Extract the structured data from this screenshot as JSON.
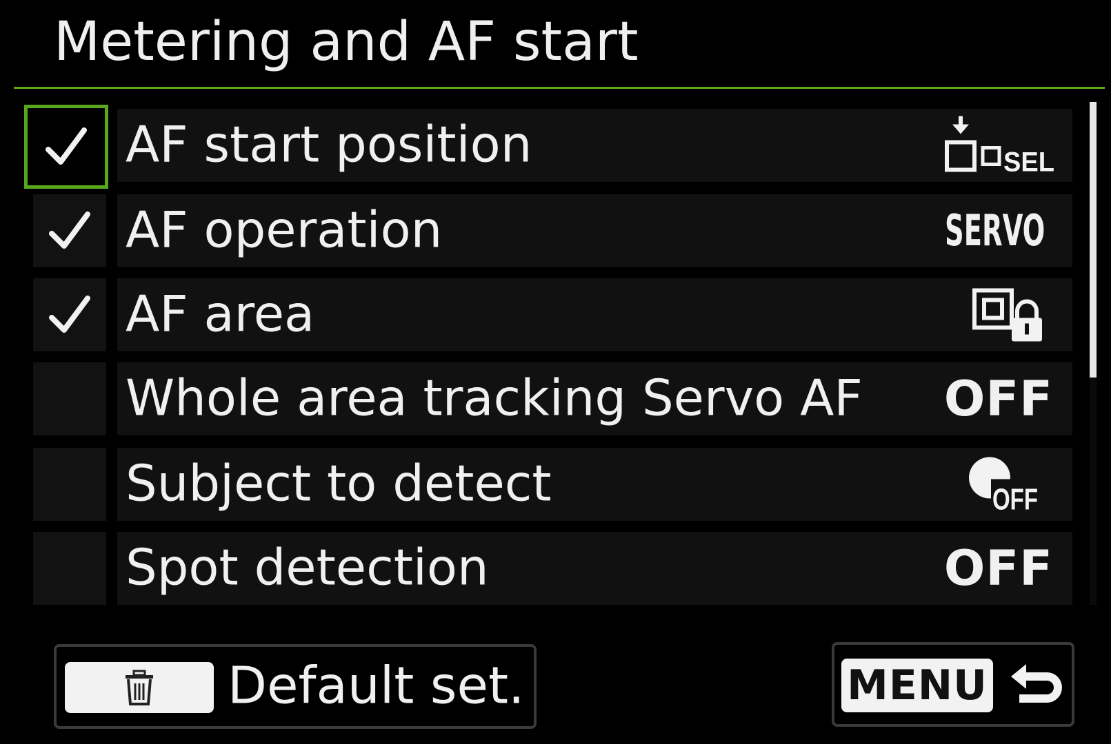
{
  "screen": {
    "title": "Metering and AF start",
    "accent_color": "#58a81e"
  },
  "items": [
    {
      "label": "AF start position",
      "checked": true,
      "focused": true,
      "value_icon": "af-start-position-sel-icon"
    },
    {
      "label": "AF operation",
      "checked": true,
      "focused": false,
      "value_text": "SERVO"
    },
    {
      "label": "AF area",
      "checked": true,
      "focused": false,
      "value_icon": "af-area-lock-icon"
    },
    {
      "label": "Whole area tracking Servo AF",
      "checked": false,
      "focused": false,
      "value_text": "OFF"
    },
    {
      "label": "Subject to detect",
      "checked": false,
      "focused": false,
      "value_icon": "subject-detect-off-icon",
      "value_text": "OFF"
    },
    {
      "label": "Spot detection",
      "checked": false,
      "focused": false,
      "value_text": "OFF"
    }
  ],
  "footer": {
    "default_label": "Default set.",
    "default_key_icon": "trash-icon",
    "menu_key_label": "MENU",
    "return_icon": "return-arrow-icon"
  }
}
